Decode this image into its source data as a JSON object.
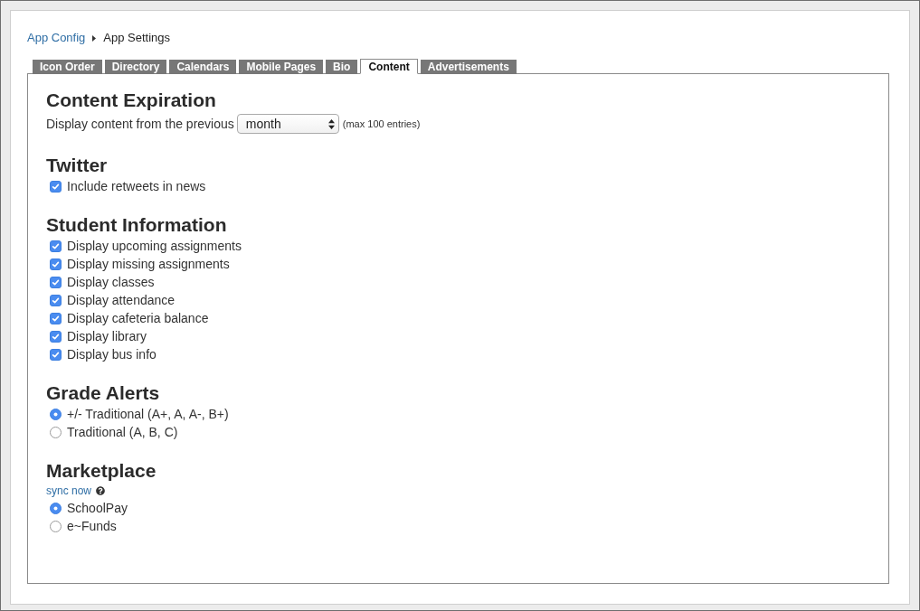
{
  "breadcrumb": [
    {
      "label": "App Config",
      "kind": "link"
    },
    {
      "label": "App Settings",
      "kind": "current"
    }
  ],
  "tabs": [
    {
      "label": "Icon Order",
      "selected": false
    },
    {
      "label": "Directory",
      "selected": false
    },
    {
      "label": "Calendars",
      "selected": false
    },
    {
      "label": "Mobile Pages",
      "selected": false
    },
    {
      "label": "Bio",
      "selected": false
    },
    {
      "label": "Content",
      "selected": true
    },
    {
      "label": "Advertisements",
      "selected": false
    }
  ],
  "sections": [
    {
      "title": "Content Expiration",
      "kind": "select",
      "label": "Display content from the previous",
      "select": {
        "value": "month"
      },
      "note": "(max 100 entries)"
    },
    {
      "title": "Twitter",
      "kind": "checkboxes",
      "options": [
        {
          "label": "Include retweets in news",
          "checked": true
        }
      ]
    },
    {
      "title": "Student Information",
      "kind": "checkboxes",
      "options": [
        {
          "label": "Display upcoming assignments",
          "checked": true
        },
        {
          "label": "Display missing assignments",
          "checked": true
        },
        {
          "label": "Display classes",
          "checked": true
        },
        {
          "label": "Display attendance",
          "checked": true
        },
        {
          "label": "Display cafeteria balance",
          "checked": true
        },
        {
          "label": "Display library",
          "checked": true
        },
        {
          "label": "Display bus info",
          "checked": true
        }
      ]
    },
    {
      "title": "Grade Alerts",
      "kind": "radios",
      "options": [
        {
          "label": "+/- Traditional (A+, A, A-, B+)",
          "selected": true
        },
        {
          "label": "Traditional (A, B, C)",
          "selected": false
        }
      ]
    },
    {
      "title": "Marketplace",
      "kind": "radios",
      "link": "sync now",
      "options": [
        {
          "label": "SchoolPay",
          "selected": true
        },
        {
          "label": "e~Funds",
          "selected": false
        }
      ]
    }
  ]
}
